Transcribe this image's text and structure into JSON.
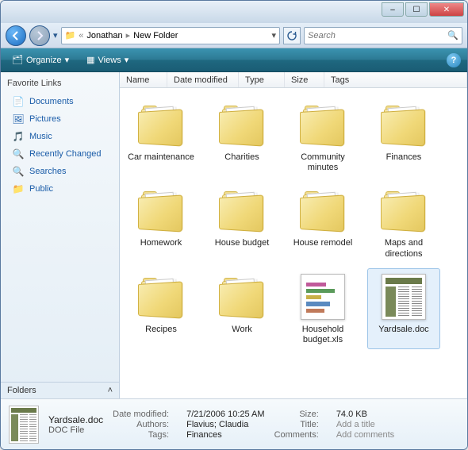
{
  "titlebar": {
    "min": "–",
    "max": "☐",
    "close": "✕"
  },
  "nav": {
    "crumbs": [
      "Jonathan",
      "New Folder"
    ],
    "search_placeholder": "Search"
  },
  "toolbar": {
    "organize": "Organize",
    "views": "Views"
  },
  "sidebar": {
    "heading": "Favorite Links",
    "links": [
      {
        "label": "Documents",
        "icon": "📄"
      },
      {
        "label": "Pictures",
        "icon": "🖼"
      },
      {
        "label": "Music",
        "icon": "🎵"
      },
      {
        "label": "Recently Changed",
        "icon": "🔍"
      },
      {
        "label": "Searches",
        "icon": "🔍"
      },
      {
        "label": "Public",
        "icon": "📁"
      }
    ],
    "folders": "Folders"
  },
  "columns": [
    "Name",
    "Date modified",
    "Type",
    "Size",
    "Tags"
  ],
  "items": [
    {
      "label": "Car maintenance",
      "kind": "folder"
    },
    {
      "label": "Charities",
      "kind": "folder"
    },
    {
      "label": "Community minutes",
      "kind": "folder"
    },
    {
      "label": "Finances",
      "kind": "folder"
    },
    {
      "label": "Homework",
      "kind": "folder"
    },
    {
      "label": "House budget",
      "kind": "folder"
    },
    {
      "label": "House remodel",
      "kind": "folder"
    },
    {
      "label": "Maps and directions",
      "kind": "folder"
    },
    {
      "label": "Recipes",
      "kind": "folder"
    },
    {
      "label": "Work",
      "kind": "folder"
    },
    {
      "label": "Household budget.xls",
      "kind": "xls"
    },
    {
      "label": "Yardsale.doc",
      "kind": "doc",
      "selected": true
    }
  ],
  "details": {
    "name": "Yardsale.doc",
    "type": "DOC File",
    "rows": {
      "date_k": "Date modified:",
      "date_v": "7/21/2006 10:25 AM",
      "auth_k": "Authors:",
      "auth_v": "Flavius; Claudia",
      "tags_k": "Tags:",
      "tags_v": "Finances",
      "size_k": "Size:",
      "size_v": "74.0 KB",
      "title_k": "Title:",
      "title_v": "Add a title",
      "comm_k": "Comments:",
      "comm_v": "Add comments"
    }
  }
}
